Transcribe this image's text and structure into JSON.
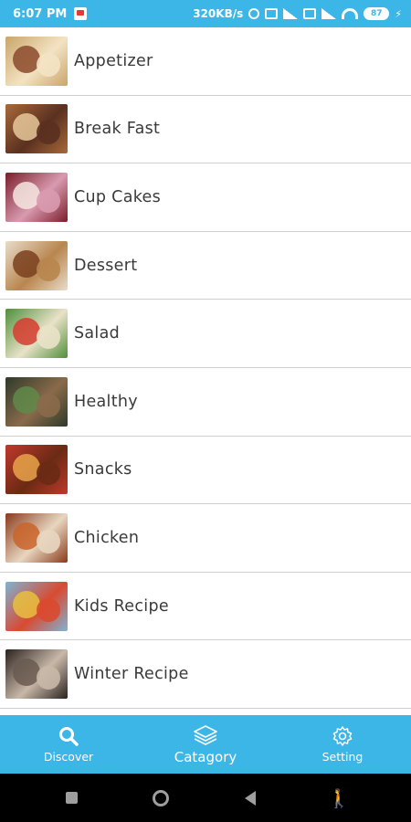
{
  "status_bar": {
    "time": "6:07 PM",
    "network_speed": "320KB/s",
    "battery": "87"
  },
  "categories": [
    {
      "label": "Appetizer",
      "colors": [
        "#c9a56a",
        "#8b4a2b",
        "#f3e3c3"
      ]
    },
    {
      "label": "Break Fast",
      "colors": [
        "#a86a3a",
        "#e8c89a",
        "#5a3020"
      ]
    },
    {
      "label": "Cup Cakes",
      "colors": [
        "#7a1e2a",
        "#f4e6e0",
        "#d99ab0"
      ]
    },
    {
      "label": "Dessert",
      "colors": [
        "#e9dccb",
        "#7a3f1f",
        "#b8864e"
      ]
    },
    {
      "label": "Salad",
      "colors": [
        "#4f8f3a",
        "#d63c2f",
        "#e9e2c8"
      ]
    },
    {
      "label": "Healthy",
      "colors": [
        "#2e3a2a",
        "#5f8a4a",
        "#8a6a4a"
      ]
    },
    {
      "label": "Snacks",
      "colors": [
        "#c0392b",
        "#e9a34a",
        "#6a2a14"
      ]
    },
    {
      "label": "Chicken",
      "colors": [
        "#8a3a1a",
        "#c9642a",
        "#e8d6c0"
      ]
    },
    {
      "label": "Kids Recipe",
      "colors": [
        "#7fb3d3",
        "#e8c040",
        "#d94a30"
      ]
    },
    {
      "label": "Winter Recipe",
      "colors": [
        "#2a2220",
        "#6a5a50",
        "#c9b8a8"
      ]
    }
  ],
  "bottom_nav": {
    "discover": "Discover",
    "category": "Catagory",
    "setting": "Setting"
  }
}
